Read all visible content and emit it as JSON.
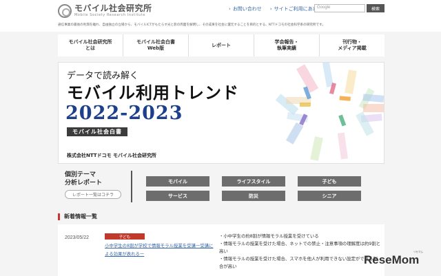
{
  "header": {
    "logo_title": "モバイル社会研究所",
    "logo_subtitle": "Mobile Society Research Institute",
    "intro_text": "通信事業の最後の利潤を離れ、自由独立の立場から、モバイルICTがもたらす光と影の両面を解明し、その成果を社会に還元することを目的とする、NTTドコモの社会科学系の研究所です。",
    "links": [
      "お問い合わせ",
      "サイトご利用にあたって"
    ],
    "search_placeholder": "Google",
    "search_button": "検索"
  },
  "nav": {
    "items": [
      {
        "line1": "モバイル社会研究所",
        "line2": "とは"
      },
      {
        "line1": "モバイル社会白書",
        "line2": "Web版"
      },
      {
        "line1": "レポート",
        "line2": ""
      },
      {
        "line1": "学会報告・",
        "line2": "執筆実績"
      },
      {
        "line1": "刊行物・",
        "line2": "メディア掲載"
      }
    ]
  },
  "hero": {
    "kicker": "データで読み解く",
    "title": "モバイル利用トレンド",
    "years": "2022-2023",
    "badge": "モバイル社会白書",
    "company": "株式会社NTTドコモ モバイル社会研究所"
  },
  "themes": {
    "title_line1": "個別テーマ",
    "title_line2": "分析レポート",
    "list_link": "レポート一覧はコチラ",
    "buttons": [
      "モバイル",
      "ライフスタイル",
      "子ども",
      "サービス",
      "防災",
      "シニア"
    ]
  },
  "news": {
    "heading": "新着情報一覧",
    "date": "2023/05/22",
    "tag": "子ども",
    "link_text": "小中学生の8割が学校で情報モラル授業を受講ー受講による効果が表れるー",
    "points": [
      "・小中学生の約8割が情報モラル授業を受けている",
      "・情報モラルの授業を受けた場合、ネットでの禁止・注意事項の理解度は約9割と高い",
      "・情報モラルの授業を受けた場合、スマホを他人が利用できない設定ができる割合が高い"
    ]
  },
  "watermark": {
    "text": "ReseMom",
    "small": "リセマム"
  }
}
